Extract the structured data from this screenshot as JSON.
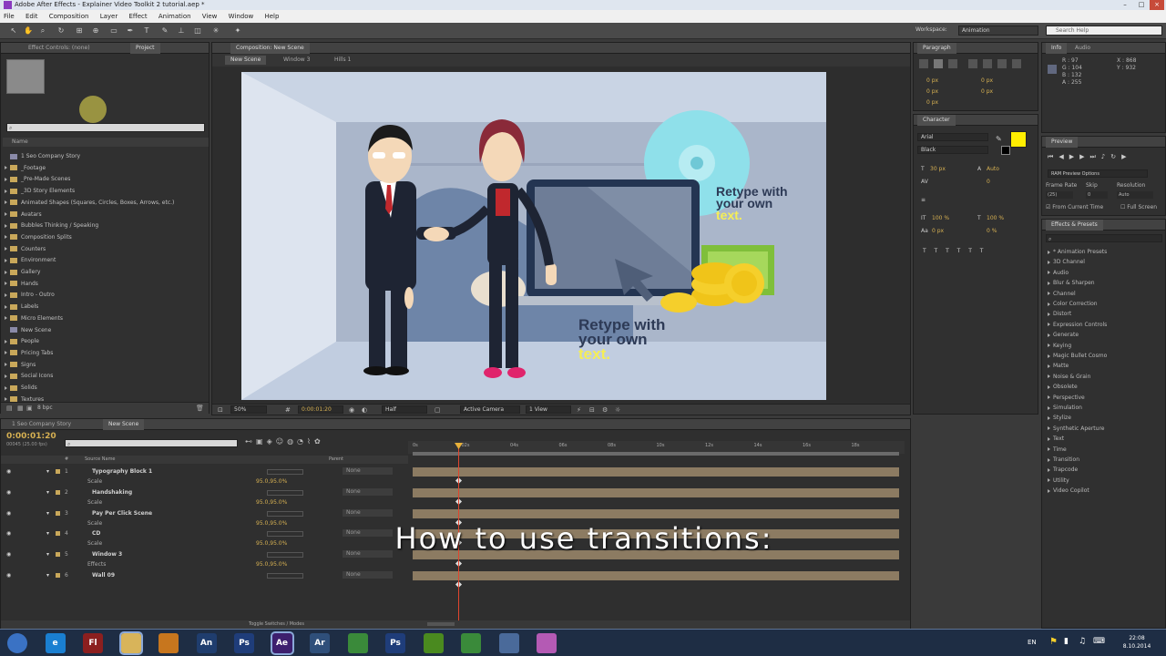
{
  "window_title": "Adobe After Effects - Explainer Video Toolkit 2 tutorial.aep *",
  "menu": [
    "File",
    "Edit",
    "Composition",
    "Layer",
    "Effect",
    "Animation",
    "View",
    "Window",
    "Help"
  ],
  "workspace": {
    "label": "Workspace:",
    "value": "Animation"
  },
  "search_help": {
    "placeholder": "Search Help"
  },
  "left_panel": {
    "tabs": [
      "Effect Controls: (none)",
      "Project"
    ],
    "search_placeholder": "",
    "column_header": "Name",
    "items": [
      {
        "label": "1 Seo Company Story",
        "type": "comp"
      },
      {
        "label": "_Footage",
        "type": "folder"
      },
      {
        "label": "_Pre-Made Scenes",
        "type": "folder"
      },
      {
        "label": "_3D Story Elements",
        "type": "folder"
      },
      {
        "label": "Animated Shapes (Squares, Circles, Boxes, Arrows, etc.)",
        "type": "folder"
      },
      {
        "label": "Avatars",
        "type": "folder"
      },
      {
        "label": "Bubbles Thinking / Speaking",
        "type": "folder"
      },
      {
        "label": "Composition Splits",
        "type": "folder"
      },
      {
        "label": "Counters",
        "type": "folder"
      },
      {
        "label": "Environment",
        "type": "folder"
      },
      {
        "label": "Gallery",
        "type": "folder"
      },
      {
        "label": "Hands",
        "type": "folder"
      },
      {
        "label": "Intro - Outro",
        "type": "folder"
      },
      {
        "label": "Labels",
        "type": "folder"
      },
      {
        "label": "Micro Elements",
        "type": "folder"
      },
      {
        "label": "New Scene",
        "type": "comp"
      },
      {
        "label": "People",
        "type": "folder"
      },
      {
        "label": "Pricing Tabs",
        "type": "folder"
      },
      {
        "label": "Signs",
        "type": "folder"
      },
      {
        "label": "Social Icons",
        "type": "folder"
      },
      {
        "label": "Solids",
        "type": "folder"
      },
      {
        "label": "Textures",
        "type": "folder"
      }
    ],
    "bpc": "8 bpc"
  },
  "composition": {
    "panel_tab": "Composition: New Scene",
    "view_tabs": [
      "New Scene",
      "Window 3",
      "Hills 1"
    ],
    "zoom": "50%",
    "timecode": "0:00:01:20",
    "resolution": "Half",
    "camera": "Active Camera",
    "views": "1 View",
    "scene_text_1": {
      "line1": "Retype with",
      "line2": "your own",
      "line3": "text."
    },
    "scene_text_2": {
      "line1": "Retype with",
      "line2": "your own",
      "line3": "text."
    }
  },
  "paragraph_panel": {
    "tabs": [
      "Paragraph"
    ],
    "values": [
      "0 px",
      "0 px",
      "0 px",
      "0 px",
      "0 px"
    ]
  },
  "character_panel": {
    "tabs": [
      "Character"
    ],
    "font": "Arial",
    "style": "Black",
    "size": "30 px",
    "leading": "Auto",
    "tracking": "0",
    "scale_v": "100 %",
    "scale_h": "100 %",
    "baseline": "0 px",
    "tsume": "0 %",
    "fill_color": "#ffee00"
  },
  "info_panel": {
    "tabs": [
      "Info",
      "Audio"
    ],
    "r": "R : 97",
    "g": "G : 104",
    "b": "B : 132",
    "a": "A : 255",
    "x": "X : 868",
    "y": "Y : 932"
  },
  "preview_panel": {
    "tabs": [
      "Preview"
    ],
    "options": "RAM Preview Options",
    "frame_rate_label": "Frame Rate",
    "skip_label": "Skip",
    "resolution_label": "Resolution",
    "frame_rate": "(25)",
    "skip": "0",
    "resolution": "Auto",
    "from_current": "From Current Time",
    "full_screen": "Full Screen"
  },
  "effects_panel": {
    "tabs": [
      "Effects & Presets"
    ],
    "items": [
      "* Animation Presets",
      "3D Channel",
      "Audio",
      "Blur & Sharpen",
      "Channel",
      "Color Correction",
      "Distort",
      "Expression Controls",
      "Generate",
      "Keying",
      "Magic Bullet Cosmo",
      "Matte",
      "Noise & Grain",
      "Obsolete",
      "Perspective",
      "Simulation",
      "Stylize",
      "Synthetic Aperture",
      "Text",
      "Time",
      "Transition",
      "Trapcode",
      "Utility",
      "Video Copilot"
    ]
  },
  "timeline": {
    "tabs": [
      "1 Seo Company Story",
      "New Scene"
    ],
    "timecode": "0:00:01:20",
    "fps_info": "00045 (25.00 fps)",
    "columns": [
      "#",
      "Source Name",
      "Parent"
    ],
    "layers": [
      {
        "num": "1",
        "name": "Typography Block 1",
        "sub": "Scale",
        "value": "95.0,95.0%",
        "parent": "None"
      },
      {
        "num": "2",
        "name": "Handshaking",
        "sub": "Scale",
        "value": "95.0,95.0%",
        "parent": "None"
      },
      {
        "num": "3",
        "name": "Pay Per Click Scene",
        "sub": "Scale",
        "value": "95.0,95.0%",
        "parent": "None"
      },
      {
        "num": "4",
        "name": "CD",
        "sub": "Scale",
        "value": "95.0,95.0%",
        "parent": "None"
      },
      {
        "num": "5",
        "name": "Window 3",
        "sub": "Effects",
        "value": "95.0,95.0%",
        "parent": "None"
      },
      {
        "num": "6",
        "name": "Wall 09",
        "sub": "",
        "value": "",
        "parent": "None"
      }
    ],
    "ruler": [
      "0s",
      "02s",
      "04s",
      "06s",
      "08s",
      "10s",
      "12s",
      "14s",
      "16s",
      "18s"
    ],
    "toggle_label": "Toggle Switches / Modes",
    "overlay_text": "How to use transitions:"
  },
  "taskbar": {
    "apps": [
      {
        "name": "windows-start",
        "label": ""
      },
      {
        "name": "internet-explorer",
        "label": "e"
      },
      {
        "name": "adobe-flash",
        "label": "Fl"
      },
      {
        "name": "file-explorer",
        "label": ""
      },
      {
        "name": "media-player",
        "label": ""
      },
      {
        "name": "adobe-animate",
        "label": "An"
      },
      {
        "name": "adobe-photoshop",
        "label": "Ps"
      },
      {
        "name": "adobe-after-effects",
        "label": "Ae"
      },
      {
        "name": "adobe-audition",
        "label": "Ar"
      },
      {
        "name": "chrome",
        "label": ""
      },
      {
        "name": "adobe-photoshop-2",
        "label": "Ps"
      },
      {
        "name": "nvidia",
        "label": ""
      },
      {
        "name": "chrome-2",
        "label": ""
      },
      {
        "name": "app-generic",
        "label": ""
      },
      {
        "name": "paint",
        "label": ""
      }
    ],
    "lang": "EN",
    "time": "22:08",
    "date": "8.10.2014"
  },
  "colors": {
    "accent": "#d6b052",
    "playhead": "#e0452e",
    "bar": "#8c7b62",
    "taskbar": "#1e2d44"
  }
}
